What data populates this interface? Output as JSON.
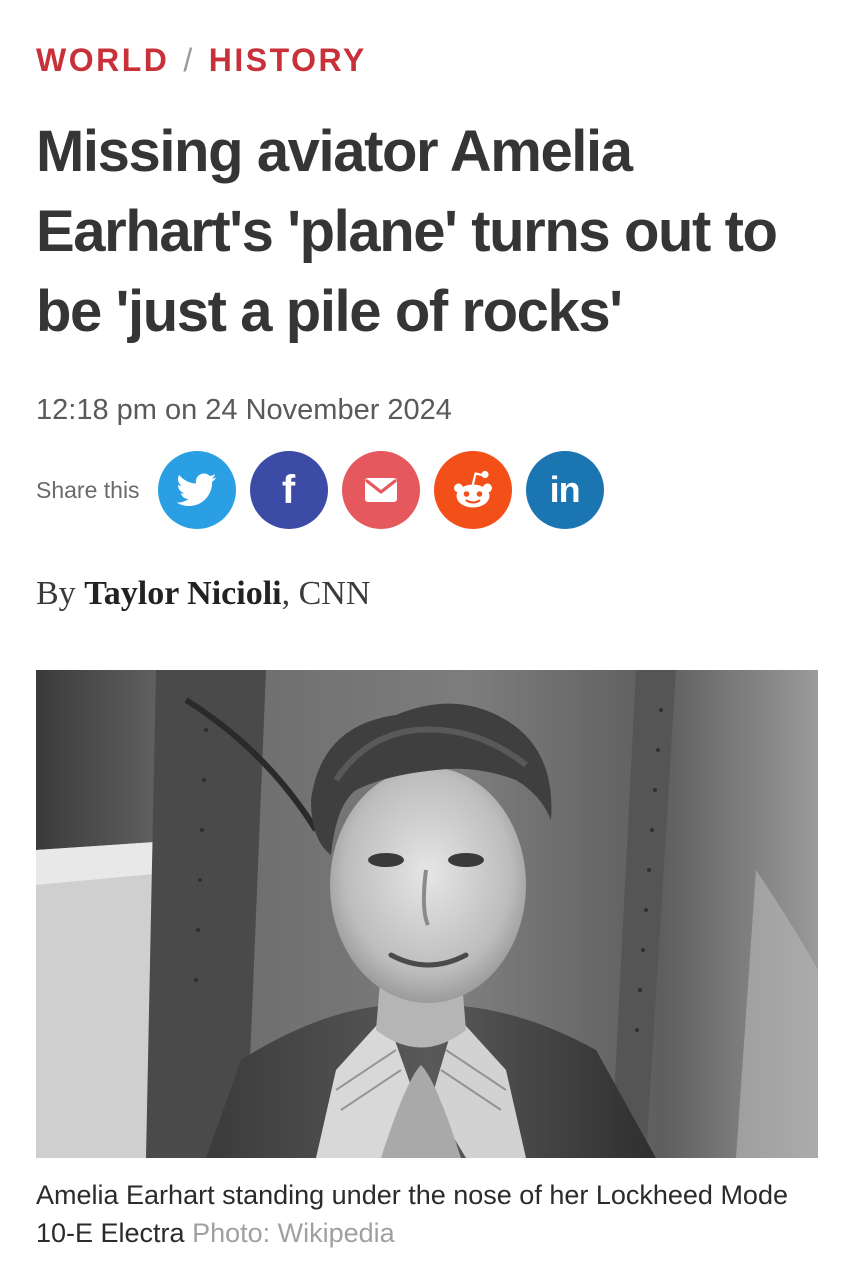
{
  "breadcrumb": {
    "section": "WORLD",
    "separator": "/",
    "subsection": "HISTORY"
  },
  "article": {
    "headline": "Missing aviator Amelia Earhart's 'plane' turns out to be 'just a pile of rocks'",
    "timestamp": "12:18 pm on 24 November 2024",
    "byline_prefix": "By",
    "author": "Taylor Nicioli",
    "byline_suffix": ", CNN"
  },
  "share": {
    "label": "Share this",
    "buttons": [
      {
        "network": "twitter",
        "icon": "twitter-bird-icon",
        "color": "#2a9fe4"
      },
      {
        "network": "facebook",
        "icon": "facebook-f-icon",
        "color": "#3c4ba6"
      },
      {
        "network": "email",
        "icon": "envelope-icon",
        "color": "#e5585e"
      },
      {
        "network": "reddit",
        "icon": "reddit-alien-icon",
        "color": "#f24f19"
      },
      {
        "network": "linkedin",
        "icon": "linkedin-in-icon",
        "color": "#1b75b1"
      }
    ],
    "facebook_glyph": "f",
    "linkedin_glyph": "in"
  },
  "photo": {
    "caption": "Amelia Earhart standing under the nose of her Lockheed Mode 10-E Electra",
    "credit": "Photo: Wikipedia"
  },
  "colors": {
    "accent": "#c8313a",
    "headline": "#353535",
    "muted": "#5a5a5a",
    "credit": "#a0a0a0"
  }
}
